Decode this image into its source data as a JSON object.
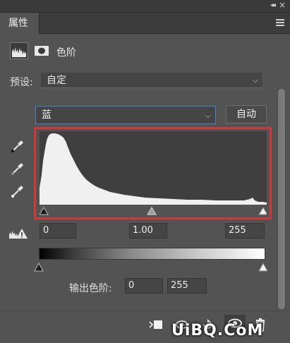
{
  "panel": {
    "tab_label": "属性",
    "adjustment_title": "色阶"
  },
  "preset": {
    "label": "预设:",
    "value": "自定"
  },
  "channel": {
    "value": "蓝",
    "auto_label": "自动"
  },
  "input_levels": {
    "black": "0",
    "gamma": "1.00",
    "white": "255"
  },
  "output_levels": {
    "label": "输出色阶:",
    "black": "0",
    "white": "255"
  },
  "watermark": "UiBQ.CoM",
  "colors": {
    "panel_bg": "#535353",
    "highlight_outline": "#d0393c",
    "channel_focus": "#4a82c4",
    "histogram_fill": "#f0f0f0"
  },
  "icons": [
    "collapse-icon",
    "close-icon",
    "panel-menu-icon",
    "histogram-adjustment-icon",
    "mask-icon",
    "black-eyedropper-icon",
    "gray-eyedropper-icon",
    "white-eyedropper-icon",
    "clipping-warning-icon",
    "clip-to-layer-icon",
    "view-previous-icon",
    "reset-icon",
    "visibility-icon",
    "delete-icon"
  ]
}
